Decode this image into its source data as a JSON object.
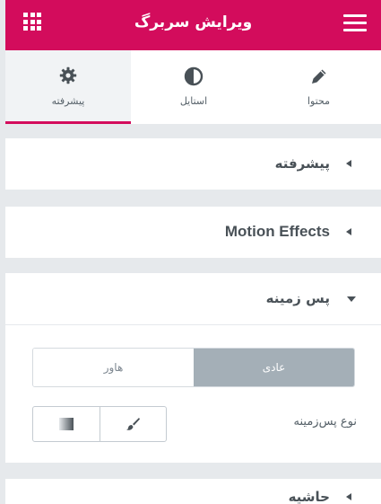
{
  "header": {
    "title": "ویرایش سربرگ",
    "menu_icon": "hamburger-menu-icon",
    "apps_icon": "apps-grid-icon",
    "brand_color": "#d30c5c"
  },
  "tabs": [
    {
      "label": "محتوا",
      "icon": "pencil-icon"
    },
    {
      "label": "استایل",
      "icon": "contrast-icon"
    },
    {
      "label": "پیشرفته",
      "icon": "gear-icon",
      "active": true
    }
  ],
  "sections": {
    "advanced": {
      "title": "پیشرفته"
    },
    "motion": {
      "title": "Motion Effects"
    },
    "background": {
      "title": "پس زمینه",
      "state_tabs": {
        "normal": "عادی",
        "hover": "هاور"
      },
      "type_label": "نوع پس‌زمینه",
      "type_options": [
        "classic-brush-icon",
        "gradient-icon"
      ]
    },
    "border": {
      "title": "حاشیه"
    }
  }
}
